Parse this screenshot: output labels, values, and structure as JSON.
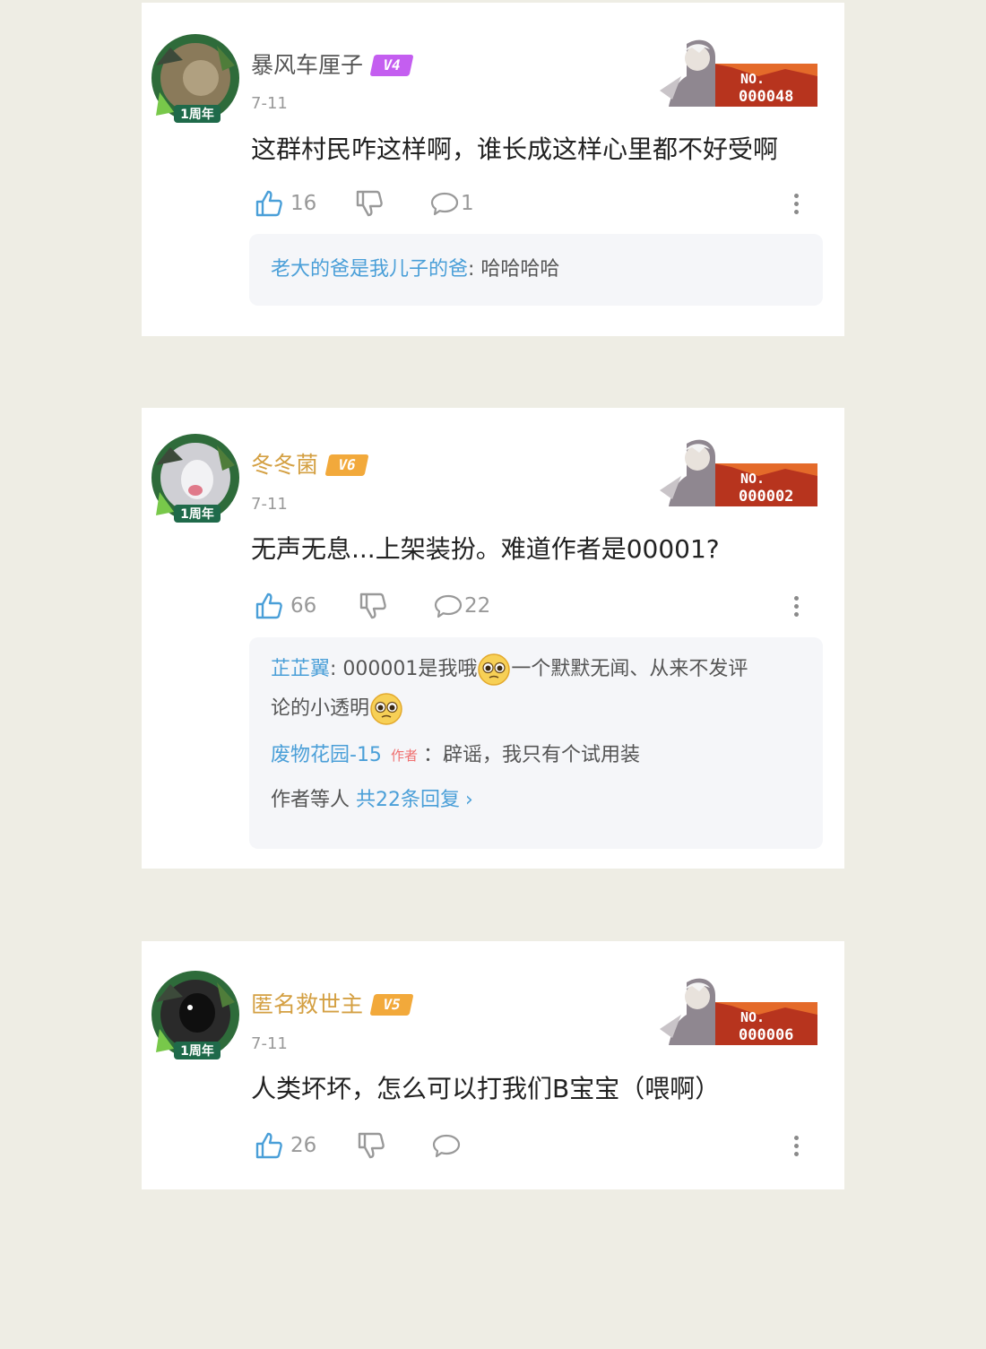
{
  "colors": {
    "page_bg": "#eeede4",
    "card_bg": "#ffffff",
    "link_blue": "#4a9fd8",
    "gold_name": "#d4a043",
    "badge_purple": "#c45ef0",
    "badge_orange": "#f2a93b"
  },
  "comments": [
    {
      "username": "暴风车厘子",
      "level": "V4",
      "date": "7-11",
      "text": "这群村民咋这样啊，谁长成这样心里都不好受啊",
      "likes": "16",
      "replies_count": "1",
      "avatar_frame_label": "1周年",
      "fan_badge": {
        "label": "NO.",
        "number": "000048"
      },
      "replies": [
        {
          "name": "老大的爸是我儿子的爸",
          "separator": ": ",
          "text": "哈哈哈哈"
        }
      ]
    },
    {
      "username": "冬冬菌",
      "level": "V6",
      "date": "7-11",
      "text": "无声无息...上架装扮。难道作者是00001?",
      "likes": "66",
      "replies_count": "22",
      "avatar_frame_label": "1周年",
      "fan_badge": {
        "label": "NO.",
        "number": "000002"
      },
      "replies": [
        {
          "name": "芷芷翼",
          "separator": ": ",
          "text_a": "000001是我哦",
          "text_b": "一个默默无闻、从来不发评",
          "text_c": "论的小透明",
          "emoji": "pleading-face"
        },
        {
          "name": "废物花园-15",
          "tag": "作者",
          "separator": "：",
          "text": "辟谣，我只有个试用装"
        }
      ],
      "more_replies": {
        "prefix": "作者等人 ",
        "link": "共22条回复",
        "chevron": "›"
      }
    },
    {
      "username": "匿名救世主",
      "level": "V5",
      "date": "7-11",
      "text": "人类坏坏，怎么可以打我们B宝宝（喂啊）",
      "likes": "26",
      "replies_count": "",
      "avatar_frame_label": "1周年",
      "fan_badge": {
        "label": "NO.",
        "number": "000006"
      }
    }
  ]
}
